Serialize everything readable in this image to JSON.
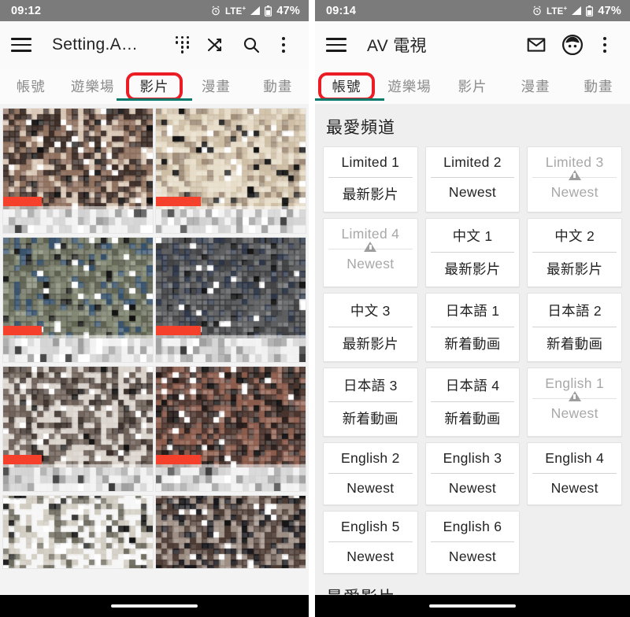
{
  "left": {
    "status": {
      "time": "09:12",
      "network": "LTE",
      "network_sup": "+",
      "battery": "47%",
      "alarm_icon": "alarm-icon",
      "signal_icon": "signal-bars-icon",
      "battery_icon": "battery-icon"
    },
    "toolbar": {
      "menu_icon": "hamburger-menu-icon",
      "title": "Setting.A…",
      "apps_icon": "apps-grid-icon",
      "shuffle_icon": "shuffle-icon",
      "search_icon": "search-icon",
      "overflow_icon": "more-vertical-icon"
    },
    "tabs": [
      {
        "label": "帳號",
        "active": false,
        "highlighted": false
      },
      {
        "label": "遊樂場",
        "active": false,
        "highlighted": false
      },
      {
        "label": "影片",
        "active": true,
        "highlighted": true
      },
      {
        "label": "漫畫",
        "active": false,
        "highlighted": false
      },
      {
        "label": "動畫",
        "active": false,
        "highlighted": false
      }
    ],
    "video_rows": [
      {
        "partial": false,
        "cards": [
          {
            "tone_a": "#3a2b25",
            "tone_b": "#8d6e5c",
            "tone_c": "#d8c6b4",
            "progress": "26%"
          },
          {
            "tone_a": "#cdbda4",
            "tone_b": "#e6dcc8",
            "tone_c": "#9d8a76",
            "progress": "30%"
          }
        ]
      },
      {
        "partial": false,
        "cards": [
          {
            "tone_a": "#5e6150",
            "tone_b": "#7e8470",
            "tone_c": "#35506b",
            "progress": "26%"
          },
          {
            "tone_a": "#3f4042",
            "tone_b": "#5c5d5f",
            "tone_c": "#2b3446",
            "progress": "30%"
          }
        ]
      },
      {
        "partial": false,
        "cards": [
          {
            "tone_a": "#6b5e56",
            "tone_b": "#d9d2cb",
            "tone_c": "#3a2f2a",
            "progress": "26%"
          },
          {
            "tone_a": "#4a332c",
            "tone_b": "#8a5a4a",
            "tone_c": "#241a18",
            "progress": "30%"
          }
        ]
      },
      {
        "partial": true,
        "cards": [
          {
            "tone_a": "#f6f6f6",
            "tone_b": "#cfcabf",
            "tone_c": "#6d6a5e",
            "progress": "0%"
          },
          {
            "tone_a": "#4b3a33",
            "tone_b": "#9c8d83",
            "tone_c": "#15151a",
            "progress": "0%"
          }
        ]
      }
    ],
    "navbar": {
      "home_indicator": "home-pill-indicator"
    }
  },
  "right": {
    "status": {
      "time": "09:14",
      "network": "LTE",
      "network_sup": "+",
      "battery": "47%",
      "alarm_icon": "alarm-icon",
      "signal_icon": "signal-bars-icon",
      "battery_icon": "battery-icon"
    },
    "toolbar": {
      "menu_icon": "hamburger-menu-icon",
      "title": "AV 電視",
      "mail_icon": "mail-envelope-icon",
      "account_icon": "account-face-icon",
      "overflow_icon": "more-vertical-icon"
    },
    "tabs": [
      {
        "label": "帳號",
        "active": true,
        "highlighted": true
      },
      {
        "label": "遊樂場",
        "active": false,
        "highlighted": false
      },
      {
        "label": "影片",
        "active": false,
        "highlighted": false
      },
      {
        "label": "漫畫",
        "active": false,
        "highlighted": false
      },
      {
        "label": "動畫",
        "active": false,
        "highlighted": false
      }
    ],
    "section_title": "最愛頻道",
    "section_title_2": "最愛影片",
    "channels": [
      {
        "name": "Limited 1",
        "status": "最新影片",
        "disabled": false,
        "warning": false
      },
      {
        "name": "Limited 2",
        "status": "Newest",
        "disabled": false,
        "warning": false
      },
      {
        "name": "Limited 3",
        "status": "Newest",
        "disabled": true,
        "warning": true
      },
      {
        "name": "Limited 4",
        "status": "Newest",
        "disabled": true,
        "warning": true
      },
      {
        "name": "中文 1",
        "status": "最新影片",
        "disabled": false,
        "warning": false
      },
      {
        "name": "中文 2",
        "status": "最新影片",
        "disabled": false,
        "warning": false
      },
      {
        "name": "中文 3",
        "status": "最新影片",
        "disabled": false,
        "warning": false
      },
      {
        "name": "日本語 1",
        "status": "新着動画",
        "disabled": false,
        "warning": false
      },
      {
        "name": "日本語 2",
        "status": "新着動画",
        "disabled": false,
        "warning": false
      },
      {
        "name": "日本語 3",
        "status": "新着動画",
        "disabled": false,
        "warning": false
      },
      {
        "name": "日本語 4",
        "status": "新着動画",
        "disabled": false,
        "warning": false
      },
      {
        "name": "English 1",
        "status": "Newest",
        "disabled": true,
        "warning": true
      },
      {
        "name": "English 2",
        "status": "Newest",
        "disabled": false,
        "warning": false
      },
      {
        "name": "English 3",
        "status": "Newest",
        "disabled": false,
        "warning": false
      },
      {
        "name": "English 4",
        "status": "Newest",
        "disabled": false,
        "warning": false
      },
      {
        "name": "English 5",
        "status": "Newest",
        "disabled": false,
        "warning": false
      },
      {
        "name": "English 6",
        "status": "Newest",
        "disabled": false,
        "warning": false
      }
    ],
    "navbar": {
      "home_indicator": "home-pill-indicator"
    }
  },
  "colors": {
    "statusbar_bg": "#7b7b7b",
    "highlight_ring": "#ec1c24",
    "tab_underline": "#00796b",
    "progress_bar": "#f5412c",
    "page_bg": "#efefef",
    "card_bg": "#ffffff",
    "disabled_text": "#a8a8a8",
    "warning_icon": "#9e9e9e"
  }
}
